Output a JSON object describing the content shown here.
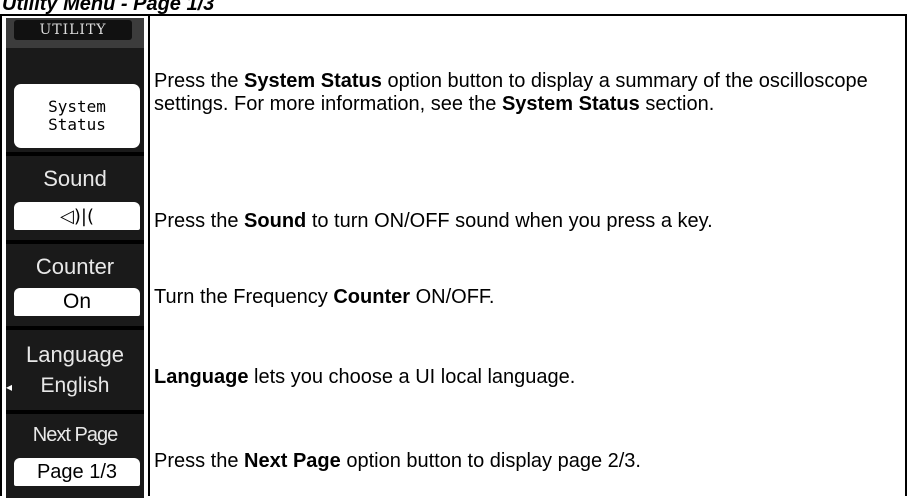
{
  "heading": "Utility Menu - Page 1/3",
  "menu": {
    "title": "UTILITY",
    "system_status": {
      "line1": "System",
      "line2": "Status"
    },
    "sound": {
      "caption": "Sound",
      "value_icon": "speaker-icon",
      "value_glyph": "◁)|("
    },
    "counter": {
      "caption": "Counter",
      "value": "On"
    },
    "language": {
      "caption": "Language",
      "value": "English",
      "arrow": "◂"
    },
    "next_page": {
      "caption": "Next Page",
      "value": "Page 1/3"
    }
  },
  "descriptions": {
    "system_status": {
      "p1": "Press the ",
      "b1": "System Status",
      "p2": " option button to display a summary of the oscilloscope settings. For more information, see the ",
      "b2": "System Status",
      "p3": " section."
    },
    "sound": {
      "p1": "Press the ",
      "b1": "Sound",
      "p2": " to turn ON/OFF sound when you press a key."
    },
    "counter": {
      "p1": "Turn the Frequency ",
      "b1": "Counter",
      "p2": " ON/OFF."
    },
    "language": {
      "b1": "Language",
      "p1": " lets you choose a UI local language."
    },
    "next_page": {
      "p1": "Press the ",
      "b1": "Next Page",
      "p2": " option button to display page 2/3."
    }
  }
}
